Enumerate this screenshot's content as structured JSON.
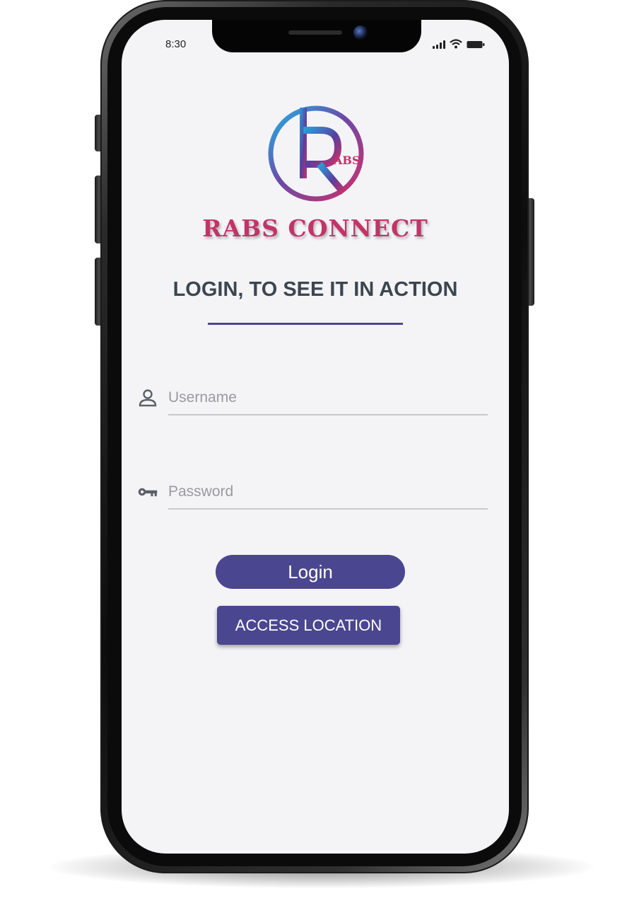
{
  "status_bar": {
    "time": "8:30",
    "icons": [
      "signal-icon",
      "wifi-icon",
      "battery-icon"
    ]
  },
  "brand": {
    "logo_letter": "R",
    "logo_suffix": "ABS",
    "name": "RABS CONNECT"
  },
  "heading": "LOGIN, TO SEE IT IN ACTION",
  "form": {
    "username": {
      "placeholder": "Username",
      "value": "",
      "icon": "person-icon"
    },
    "password": {
      "placeholder": "Password",
      "value": "",
      "icon": "key-icon"
    }
  },
  "buttons": {
    "login_label": "Login",
    "access_location_label": "ACCESS LOCATION"
  },
  "colors": {
    "accent": "#4a4690",
    "brand": "#c33466",
    "heading": "#3c4650",
    "screen_bg": "#f4f4f7"
  }
}
